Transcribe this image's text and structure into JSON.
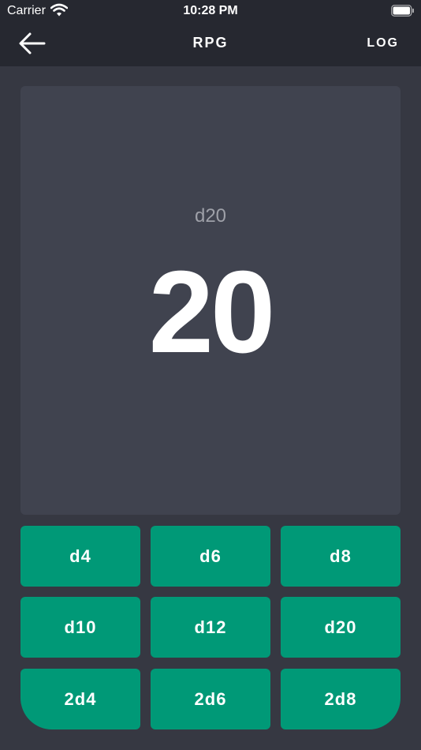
{
  "status_bar": {
    "carrier": "Carrier",
    "time": "10:28 PM"
  },
  "nav": {
    "title": "RPG",
    "log_label": "LOG",
    "back_icon": "arrow-left-icon"
  },
  "result": {
    "die": "d20",
    "value": "20"
  },
  "dice_buttons": [
    "d4",
    "d6",
    "d8",
    "d10",
    "d12",
    "d20",
    "2d4",
    "2d6",
    "2d8"
  ],
  "colors": {
    "background": "#363842",
    "bar": "#262830",
    "panel": "#40434f",
    "accent": "#009977",
    "muted_text": "#9ea0a8"
  }
}
